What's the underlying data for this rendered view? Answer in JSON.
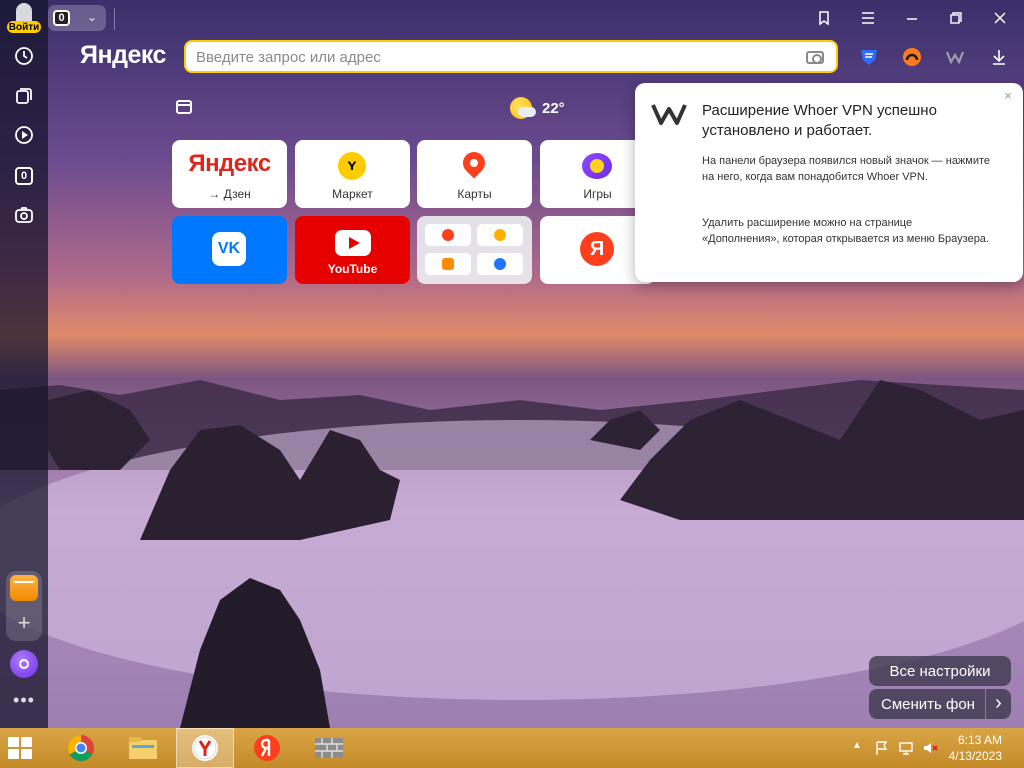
{
  "sidebar": {
    "login_label": "Войти",
    "tab_count": "0",
    "items": [
      {
        "name": "history",
        "icon": "clock-icon"
      },
      {
        "name": "collections",
        "icon": "cards-icon"
      },
      {
        "name": "media",
        "icon": "play-icon"
      },
      {
        "name": "tabs",
        "icon": "tab-counter-icon",
        "value": "0"
      },
      {
        "name": "screenshot",
        "icon": "camera-icon"
      }
    ],
    "more": "•••"
  },
  "titlebar": {
    "tab_count": "0",
    "buttons": [
      "bookmarks-icon",
      "menu-icon",
      "minimize-icon",
      "restore-icon",
      "close-icon"
    ]
  },
  "toolbar": {
    "logo": "Яндекс",
    "search_placeholder": "Введите запрос или адрес",
    "extensions": [
      "shield-extension-icon",
      "vpn-extension-icon",
      "whoer-extension-icon",
      "download-icon"
    ]
  },
  "weather": {
    "temperature": "22°"
  },
  "tiles": [
    {
      "label": "→ Дзен",
      "brand": "Яндекс"
    },
    {
      "label": "Маркет"
    },
    {
      "label": "Карты"
    },
    {
      "label": "Игры"
    },
    {
      "label": "",
      "brand": "VK"
    },
    {
      "label": "YouTube"
    },
    {
      "label": ""
    },
    {
      "label": "",
      "brand": "Я"
    }
  ],
  "popup": {
    "title": "Расширение Whoer VPN успешно установлено и работает.",
    "paragraph1": "На панели браузера появился новый значок — нажмите на него, когда вам понадобится Whoer VPN.",
    "paragraph2": "Удалить расширение можно на странице «Дополнения», которая открывается из меню Браузера.",
    "close": "×"
  },
  "bottom_actions": {
    "all_settings": "Все настройки",
    "change_background": "Сменить фон",
    "arrow": "›"
  },
  "taskbar": {
    "apps": [
      "chrome-icon",
      "file-explorer-icon",
      "yandex-browser-icon",
      "yandex-icon",
      "firewall-icon"
    ],
    "time": "6:13 AM",
    "date": "4/13/2023"
  },
  "colors": {
    "accent_yellow": "#ffcc00",
    "taskbar": "#c48a28",
    "vk_blue": "#0077ff",
    "youtube_red": "#e60000"
  }
}
